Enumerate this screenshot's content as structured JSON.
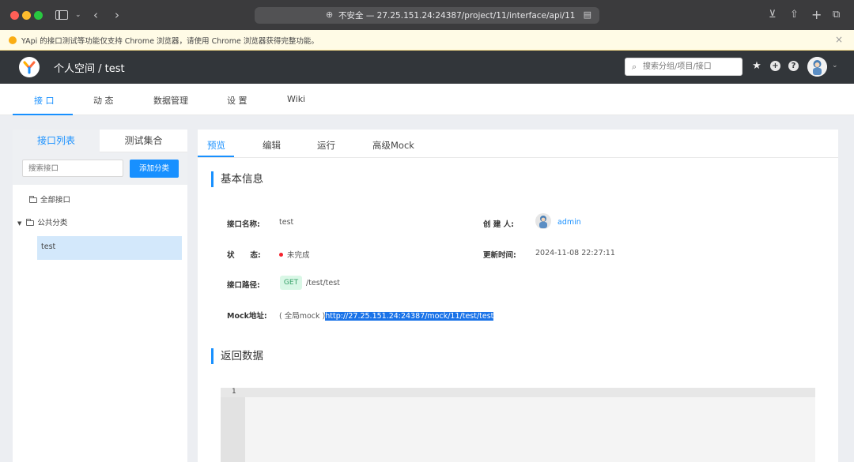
{
  "browser": {
    "url": "不安全 — 27.25.151.24:24387/project/11/interface/api/11"
  },
  "warning": {
    "text": "YApi 的接口测试等功能仅支持 Chrome 浏览器，请使用 Chrome 浏览器获得完整功能。"
  },
  "header": {
    "breadcrumb": "个人空间 / test",
    "search_placeholder": "搜索分组/项目/接口"
  },
  "subnav": {
    "items": [
      "接 口",
      "动 态",
      "数据管理",
      "设 置",
      "Wiki"
    ]
  },
  "left": {
    "tabs": [
      "接口列表",
      "测试集合"
    ],
    "search_placeholder": "搜索接口",
    "add_button": "添加分类",
    "tree": {
      "all": "全部接口",
      "category": "公共分类",
      "item": "test"
    }
  },
  "main": {
    "tabs": [
      "预览",
      "编辑",
      "运行",
      "高级Mock"
    ],
    "basic_title": "基本信息",
    "labels": {
      "name": "接口名称:",
      "status": "状      态:",
      "path": "接口路径:",
      "mock": "Mock地址:",
      "creator": "创 建 人:",
      "updated": "更新时间:"
    },
    "values": {
      "name": "test",
      "status": "未完成",
      "method": "GET",
      "path": "/test/test",
      "mock_prefix": "( 全局mock )",
      "mock_url": "http://27.25.151.24:24387/mock/11/test/test",
      "creator": "admin",
      "updated": "2024-11-08 22:27:11"
    },
    "return_title": "返回数据",
    "editor_line": "1"
  },
  "colors": {
    "accent": "#1890ff",
    "header_bg": "#32363a",
    "status_red": "#f5222d",
    "get_green": "#38a169"
  }
}
